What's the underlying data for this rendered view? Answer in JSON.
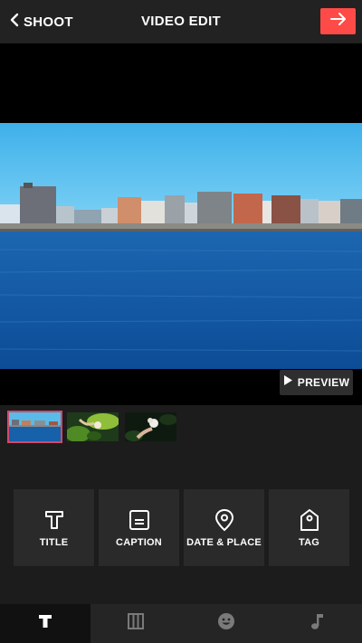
{
  "header": {
    "back_label": "SHOOT",
    "title": "VIDEO EDIT",
    "next_icon": "arrow-right-icon",
    "accent": "#ff4b47"
  },
  "video": {
    "preview_label": "PREVIEW"
  },
  "timeline": {
    "clips": [
      {
        "name": "clip-seaside",
        "selected": true
      },
      {
        "name": "clip-flower-leaves",
        "selected": false
      },
      {
        "name": "clip-flower-hand",
        "selected": false
      }
    ]
  },
  "tools": [
    {
      "label": "TITLE",
      "icon": "text-t-icon"
    },
    {
      "label": "CAPTION",
      "icon": "caption-box-icon"
    },
    {
      "label": "DATE & PLACE",
      "icon": "location-pin-icon"
    },
    {
      "label": "TAG",
      "icon": "tag-icon"
    }
  ],
  "tabs": [
    {
      "icon": "text-t-icon",
      "active": true
    },
    {
      "icon": "filmstrip-icon",
      "active": false
    },
    {
      "icon": "emoji-icon",
      "active": false
    },
    {
      "icon": "music-note-icon",
      "active": false
    }
  ]
}
